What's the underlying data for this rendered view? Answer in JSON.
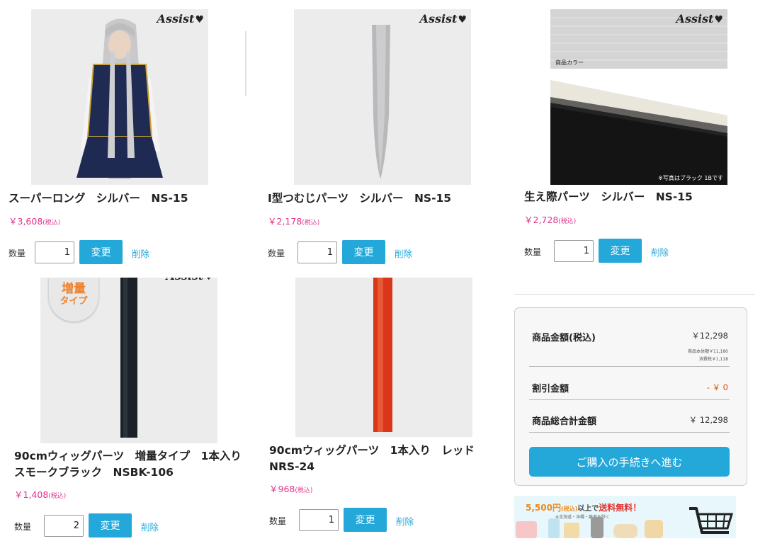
{
  "brand": {
    "logo_text": "Assist"
  },
  "products": [
    {
      "title": "スーパーロング　シルバー　NS-15",
      "price": "￥3,608",
      "tax": "(税込)",
      "qty_label": "数量",
      "qty": "1",
      "change_label": "変更",
      "delete_label": "削除"
    },
    {
      "title": "I型つむじパーツ　シルバー　NS-15",
      "price": "￥2,178",
      "tax": "(税込)",
      "qty_label": "数量",
      "qty": "1",
      "change_label": "変更",
      "delete_label": "削除"
    },
    {
      "title": "生え際パーツ　シルバー　NS-15",
      "price": "￥2,728",
      "tax": "(税込)",
      "qty_label": "数量",
      "qty": "1",
      "change_label": "変更",
      "delete_label": "削除",
      "image_caption_top": "商品カラー",
      "image_caption_bottom": "※写真はブラック 1Bです"
    },
    {
      "title_line1": "90cmウィッグパーツ　増量タイプ　1本入り",
      "title_line2": "スモークブラック　NSBK-106",
      "price": "￥1,408",
      "tax": "(税込)",
      "qty_label": "数量",
      "qty": "2",
      "change_label": "変更",
      "delete_label": "削除",
      "badge_line1": "増量",
      "badge_line2": "タイプ"
    },
    {
      "title_line1": "90cmウィッグパーツ　1本入り　レッド",
      "title_line2": "NRS-24",
      "price": "￥968",
      "tax": "(税込)",
      "qty_label": "数量",
      "qty": "1",
      "change_label": "変更",
      "delete_label": "削除"
    }
  ],
  "summary": {
    "subtotal_label": "商品金額(税込)",
    "subtotal_value": "￥12,298",
    "subtotal_breakdown_1": "商品本体額￥11,180",
    "subtotal_breakdown_2": "消費税￥1,118",
    "discount_label": "割引金額",
    "discount_value": "- ￥ 0",
    "total_label": "商品総合計金額",
    "total_value": "￥ 12,298",
    "checkout_label": "ご購入の手続きへ進む"
  },
  "banner": {
    "amount": "5,500円",
    "tax": "(税込)",
    "text": "以上で",
    "highlight": "送料無料！",
    "subtext": "※北海道・沖縄・離島を除く"
  },
  "colors": {
    "accent": "#23a8d9",
    "price": "#e0338a",
    "discount": "#d35400"
  }
}
